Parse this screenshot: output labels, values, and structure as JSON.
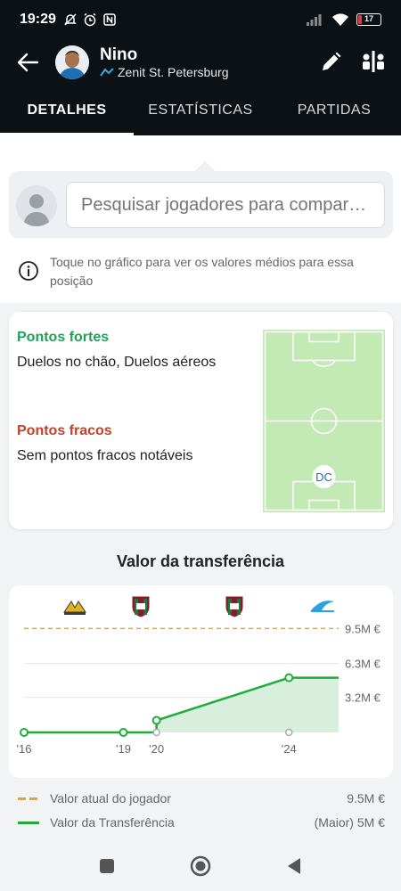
{
  "status_bar": {
    "time": "19:29",
    "battery": "17"
  },
  "player": {
    "name": "Nino",
    "club": "Zenit St. Petersburg"
  },
  "tabs": [
    {
      "label": "DETALHES",
      "active": true
    },
    {
      "label": "ESTATÍSTICAS",
      "active": false
    },
    {
      "label": "PARTIDAS",
      "active": false
    }
  ],
  "compare": {
    "placeholder": "Pesquisar jogadores para comparar..."
  },
  "info": {
    "text": "Toque no gráfico para ver os valores médios para essa posição"
  },
  "strengths": {
    "strong_title": "Pontos fortes",
    "strong_text": "Duelos no chão, Duelos aéreos",
    "weak_title": "Pontos fracos",
    "weak_text": "Sem pontos fracos notáveis",
    "position": "DC"
  },
  "transfer": {
    "title": "Valor da transferência",
    "current_label": "Valor atual do jogador",
    "current_value": "9.5M €",
    "transfer_label": "Valor da Transferência",
    "transfer_value": "(Maior) 5M €"
  },
  "chart_data": {
    "type": "line",
    "x_ticks": [
      "'16",
      "'19",
      "'20",
      "'24"
    ],
    "y_ticks": [
      "9.5M €",
      "6.3M €",
      "3.2M €"
    ],
    "y_tick_values": [
      9.5,
      6.3,
      3.2
    ],
    "ylim": [
      0,
      11
    ],
    "xlim": [
      2016,
      2025.5
    ],
    "series": [
      {
        "name": "Valor da Transferência",
        "points": [
          [
            2016,
            0
          ],
          [
            2019,
            0
          ],
          [
            2020,
            0
          ],
          [
            2020,
            1.1
          ],
          [
            2024,
            5.0
          ],
          [
            2025.5,
            5.0
          ]
        ]
      },
      {
        "name": "Valor atual do jogador",
        "value": 9.5
      }
    ],
    "colors": {
      "transfer": "#1fad3a",
      "current": "#e4a72b",
      "area": "#d9efde"
    },
    "clubs": [
      "oeste-fc",
      "fluminense",
      "fluminense",
      "zenit"
    ]
  },
  "colors": {
    "strong": "#22a05a",
    "weak": "#c0442b",
    "header": "#0c1115",
    "pitch": "#c3e9b4"
  }
}
